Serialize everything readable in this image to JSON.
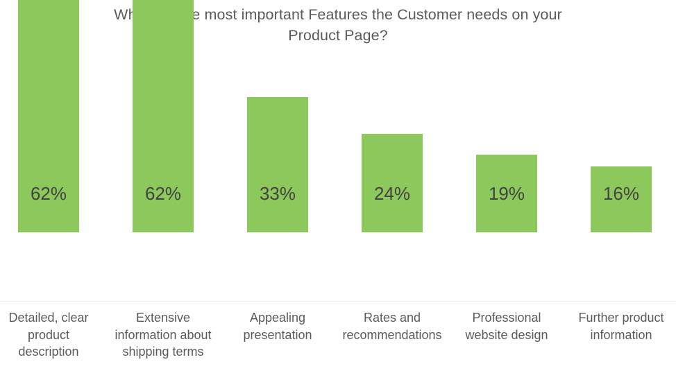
{
  "chart_data": {
    "type": "bar",
    "title": "What are the most important Features the Customer needs on your Product Page?",
    "title_line1": "What are the most important Features the Customer needs on your",
    "title_line2": "Product Page?",
    "xlabel": "",
    "ylabel": "",
    "ylim": [
      0,
      70
    ],
    "grid": false,
    "legend": null,
    "value_suffix": "%",
    "bar_color": "#8dc85c",
    "title_color": "#5a5a5a",
    "label_color": "#5a5a5a",
    "value_color": "#434343",
    "axis_line_color": "#f1f1f1",
    "categories": [
      "Detailed, clear product description",
      "Extensive information about shipping terms",
      "Appealing presentation",
      "Rates and recommendations",
      "Professional website design",
      "Further product information"
    ],
    "category_lines": [
      "Detailed, clear\nproduct\ndescription",
      "Extensive\ninformation about\nshipping terms",
      "Appealing\npresentation",
      "Rates and\nrecommendations",
      "Professional\nwebsite design",
      "Further product\ninformation"
    ],
    "values": [
      62,
      62,
      33,
      24,
      19,
      16
    ],
    "value_labels": [
      "62%",
      "62%",
      "33%",
      "24%",
      "19%",
      "16%"
    ]
  }
}
